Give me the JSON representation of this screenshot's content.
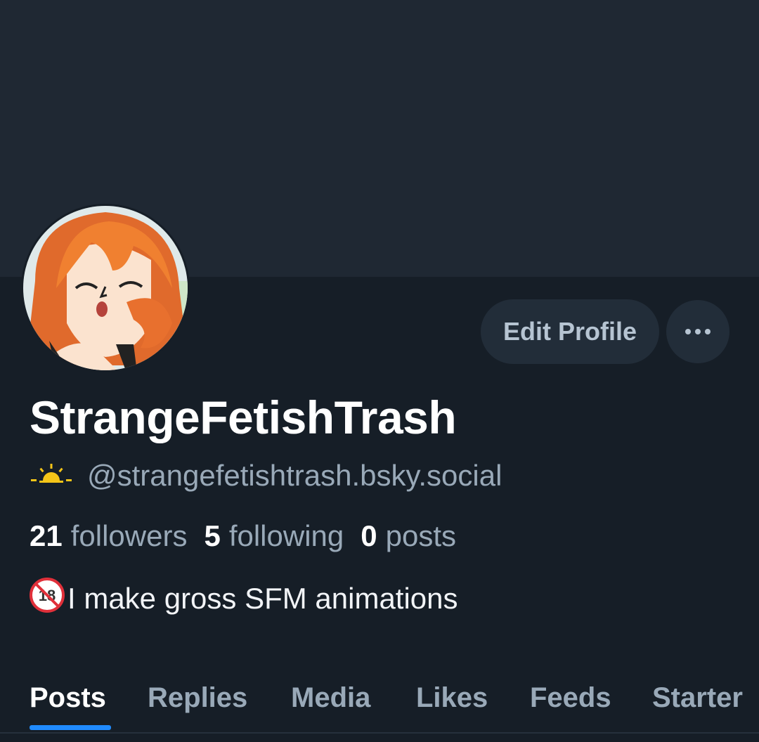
{
  "profile": {
    "display_name": "StrangeFetishTrash",
    "handle": "@strangefetishtrash.bsky.social",
    "handle_icon": "sunrise-icon",
    "bio": "I make gross SFM animations",
    "bio_icon": "no-under-18-icon"
  },
  "stats": {
    "followers_count": "21",
    "followers_label": "followers",
    "following_count": "5",
    "following_label": "following",
    "posts_count": "0",
    "posts_label": "posts"
  },
  "actions": {
    "edit_profile_label": "Edit Profile",
    "more_icon": "more-horizontal-icon"
  },
  "tabs": [
    {
      "label": "Posts",
      "active": true
    },
    {
      "label": "Replies",
      "active": false
    },
    {
      "label": "Media",
      "active": false
    },
    {
      "label": "Likes",
      "active": false
    },
    {
      "label": "Feeds",
      "active": false
    },
    {
      "label": "Starter",
      "active": false
    }
  ],
  "colors": {
    "background": "#161e27",
    "banner": "#1f2833",
    "button_bg": "#222d39",
    "accent": "#208bfe",
    "muted_text": "#99a9b8"
  }
}
